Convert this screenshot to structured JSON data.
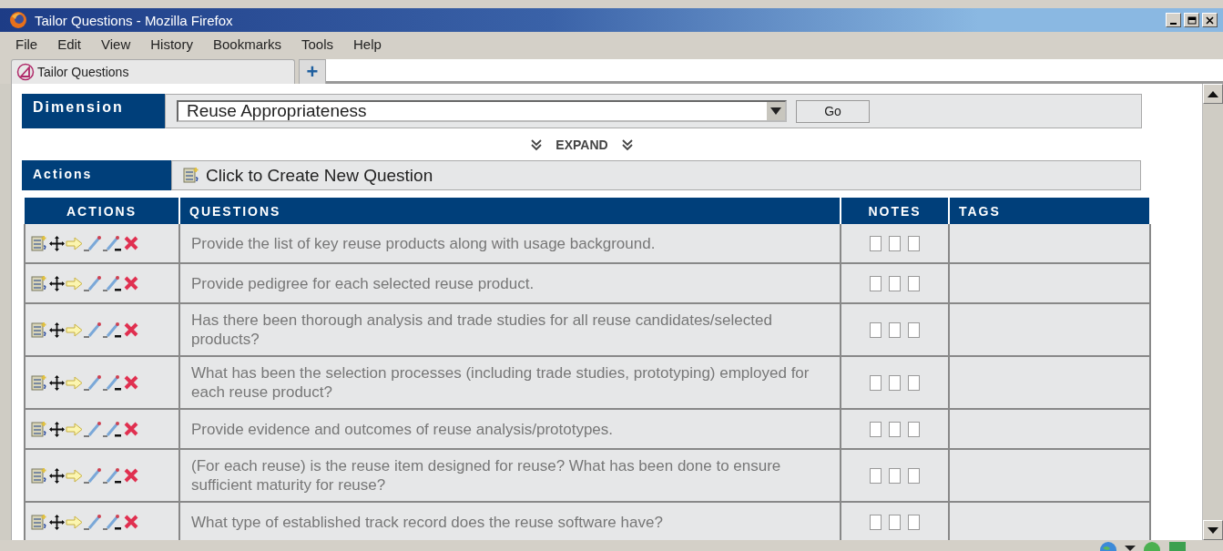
{
  "window": {
    "title": "Tailor Questions - Mozilla Firefox"
  },
  "menu": [
    {
      "label": "File"
    },
    {
      "label": "Edit"
    },
    {
      "label": "View"
    },
    {
      "label": "History"
    },
    {
      "label": "Bookmarks"
    },
    {
      "label": "Tools"
    },
    {
      "label": "Help"
    }
  ],
  "tabs": [
    {
      "label": "Tailor Questions",
      "selected": true
    }
  ],
  "new_tab": "+",
  "dimension": {
    "label": "Dimension",
    "value": "Reuse Appropriateness",
    "button": "Go"
  },
  "expand": "EXPAND",
  "actions_bar": {
    "label": "Actions",
    "link": "Click to Create New Question"
  },
  "table": {
    "columns": [
      "ACTIONS",
      "QUESTIONS",
      "NOTES",
      "TAGS"
    ],
    "rows": [
      {
        "question": "Provide the list of key reuse products along with usage background.",
        "notes": [
          {
            "checked": false
          },
          {
            "checked": false
          },
          {
            "checked": false
          }
        ]
      },
      {
        "question": "Provide pedigree for each selected reuse product.",
        "notes": [
          {
            "checked": false
          },
          {
            "checked": false
          },
          {
            "checked": false
          }
        ]
      },
      {
        "question": "Has there been thorough analysis and trade studies for all reuse candidates/selected products?",
        "notes": [
          {
            "checked": false
          },
          {
            "checked": false
          },
          {
            "checked": false
          }
        ]
      },
      {
        "question": "What has been the selection processes (including trade studies, prototyping) employed for each reuse product?",
        "notes": [
          {
            "checked": false
          },
          {
            "checked": false
          },
          {
            "checked": false
          }
        ]
      },
      {
        "question": "Provide evidence and outcomes of reuse analysis/prototypes.",
        "notes": [
          {
            "checked": false
          },
          {
            "checked": false
          },
          {
            "checked": false
          }
        ]
      },
      {
        "question": "(For each reuse) is the reuse item designed for reuse? What has been done to ensure sufficient maturity for reuse?",
        "notes": [
          {
            "checked": false
          },
          {
            "checked": false
          },
          {
            "checked": false
          }
        ]
      },
      {
        "question": "What type of established track record does the reuse software have?",
        "notes": [
          {
            "checked": false
          },
          {
            "checked": false
          },
          {
            "checked": false
          }
        ]
      }
    ]
  }
}
